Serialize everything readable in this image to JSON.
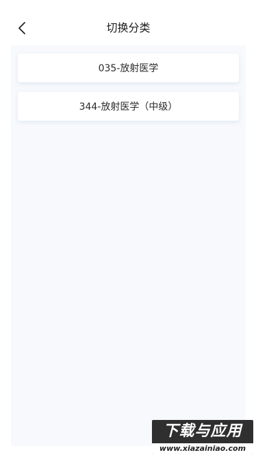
{
  "header": {
    "title": "切换分类",
    "back_icon": "chevron-left-icon"
  },
  "categories": [
    {
      "label": "035-放射医学"
    },
    {
      "label": "344-放射医学（中级）"
    }
  ],
  "watermark": {
    "brand": "下载与应用",
    "url": "www.xiazainiao.com"
  },
  "colors": {
    "background": "#f7f9fc",
    "card": "#ffffff",
    "text": "#1a1a1a"
  }
}
